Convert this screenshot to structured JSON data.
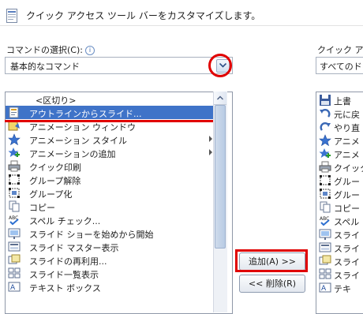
{
  "header": {
    "title": "クイック アクセス ツール バーをカスタマイズします。"
  },
  "left": {
    "label": "コマンドの選択(C):",
    "info": "i",
    "combo_value": "基本的なコマンド",
    "separator": "<区切り>",
    "items": [
      {
        "label": "アウトラインからスライド...",
        "icon": "outline-icon",
        "selected": true
      },
      {
        "label": "アニメーション ウィンドウ",
        "icon": "animation-pane-icon"
      },
      {
        "label": "アニメーション スタイル",
        "icon": "star-icon",
        "submenu": true
      },
      {
        "label": "アニメーションの追加",
        "icon": "star-plus-icon",
        "submenu": true
      },
      {
        "label": "クイック印刷",
        "icon": "printer-icon"
      },
      {
        "label": "グループ解除",
        "icon": "ungroup-icon"
      },
      {
        "label": "グループ化",
        "icon": "group-icon"
      },
      {
        "label": "コピー",
        "icon": "copy-icon"
      },
      {
        "label": "スペル チェック...",
        "icon": "spellcheck-icon"
      },
      {
        "label": "スライド ショーを始めから開始",
        "icon": "slideshow-start-icon"
      },
      {
        "label": "スライド マスター表示",
        "icon": "slide-master-icon"
      },
      {
        "label": "スライドの再利用...",
        "icon": "reuse-slides-icon"
      },
      {
        "label": "スライド一覧表示",
        "icon": "slide-sorter-icon"
      },
      {
        "label": "テキスト ボックス",
        "icon": "textbox-icon"
      }
    ]
  },
  "buttons": {
    "add": "追加(A) >>",
    "remove": "<< 削除(R)"
  },
  "right": {
    "label": "クイック アク",
    "combo_value": "すべてのドキ",
    "items": [
      {
        "label": "上書",
        "icon": "save-icon"
      },
      {
        "label": "元に戻",
        "icon": "undo-icon"
      },
      {
        "label": "やり直",
        "icon": "redo-icon"
      },
      {
        "label": "アニメ",
        "icon": "star-icon"
      },
      {
        "label": "アニメ",
        "icon": "star-plus-icon"
      },
      {
        "label": "クイック",
        "icon": "printer-icon"
      },
      {
        "label": "グルー",
        "icon": "ungroup-icon"
      },
      {
        "label": "グルー",
        "icon": "group-icon"
      },
      {
        "label": "コピー",
        "icon": "copy-icon"
      },
      {
        "label": "スペル",
        "icon": "spellcheck-icon"
      },
      {
        "label": "スライ",
        "icon": "slideshow-start-icon"
      },
      {
        "label": "スライ",
        "icon": "slide-master-icon"
      },
      {
        "label": "スライ",
        "icon": "reuse-slides-icon"
      },
      {
        "label": "スライ",
        "icon": "slide-sorter-icon"
      },
      {
        "label": "テキ",
        "icon": "textbox-icon"
      }
    ]
  },
  "colors": {
    "selection": "#3f73c8",
    "highlight_red": "#e00000"
  }
}
